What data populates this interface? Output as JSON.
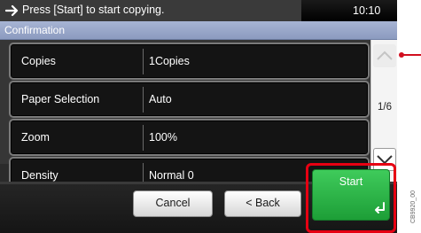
{
  "status": {
    "message": "Press [Start] to start copying.",
    "time": "10:10",
    "arrow_icon": "arrow-right-icon"
  },
  "title": "Confirmation",
  "settings": [
    {
      "name": "Copies",
      "value": "1Copies"
    },
    {
      "name": "Paper Selection",
      "value": "Auto"
    },
    {
      "name": "Zoom",
      "value": "100%"
    },
    {
      "name": "Density",
      "value": "Normal 0"
    }
  ],
  "scroll": {
    "page": "1/6",
    "up_icon": "chevron-up-icon",
    "down_icon": "chevron-down-icon"
  },
  "buttons": {
    "cancel": "Cancel",
    "back": "< Back",
    "start": "Start",
    "start_icon": "enter-icon"
  },
  "figure_code": "CB9920_00",
  "colors": {
    "start_green": "#2fb84a",
    "highlight_red": "#e60012",
    "title_bar": "#9aa8cb"
  }
}
